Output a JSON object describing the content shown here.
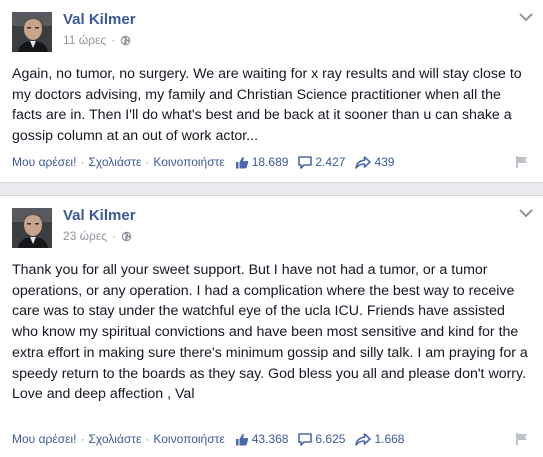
{
  "posts": [
    {
      "author": "Val Kilmer",
      "time": "11 ώρες",
      "text": "Again, no tumor, no surgery. We are waiting for x ray results and will stay close to my doctors advising, my family and Christian Science practitioner when all the facts are in. Then I'll do what's best and be back at it sooner than u can shake a gossip column at an out of work actor...",
      "like_label": "Μου αρέσει!",
      "comment_label": "Σχολιάστε",
      "share_label": "Κοινοποιήστε",
      "likes": "18.689",
      "comments": "2.427",
      "shares": "439"
    },
    {
      "author": "Val Kilmer",
      "time": "23 ώρες",
      "text": "Thank you for all your sweet support. But I have not had a tumor, or a tumor operations, or any operation. I had a complication where the best way to receive care was to stay under the watchful eye of the ucla ICU. Friends have assisted who know my spiritual convictions and have been most sensitive and kind for the extra effort in making sure there's minimum gossip and silly talk. I am praying for a speedy return to the boards as they say. God bless you all and please don't worry. Love and deep affection , Val",
      "like_label": "Μου αρέσει!",
      "comment_label": "Σχολιάστε",
      "share_label": "Κοινοποιήστε",
      "likes": "43.368",
      "comments": "6.625",
      "shares": "1.668"
    }
  ],
  "icons": {
    "privacy": "globe-icon",
    "menu": "chevron-down-icon",
    "like": "thumbs-up-icon",
    "comment": "comment-icon",
    "share": "share-arrow-icon",
    "report": "flag-icon"
  },
  "colors": {
    "link": "#3b5998",
    "muted": "#90949c",
    "background": "#e9ebee"
  }
}
